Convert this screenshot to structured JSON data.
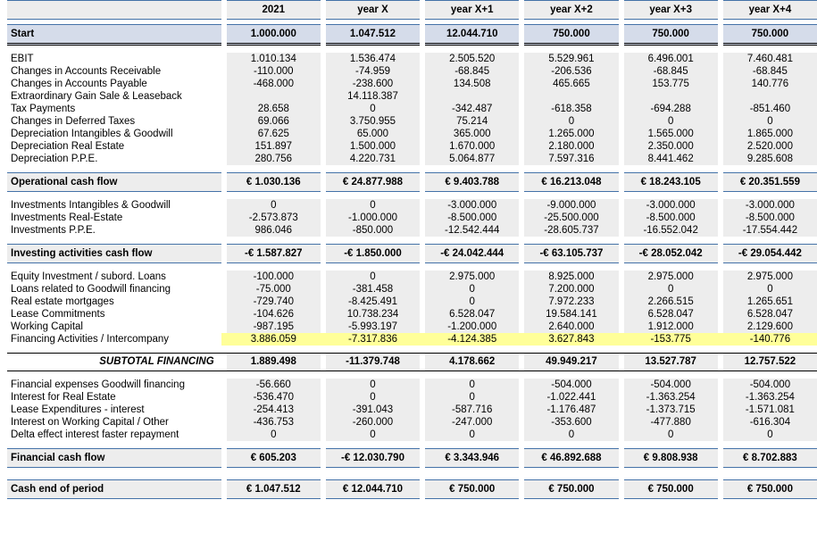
{
  "colors": {
    "accent_border": "#4472a8",
    "header_fill": "#ededed",
    "start_fill": "#d5dcea",
    "highlight_fill": "#ffff99",
    "total_border": "#000000"
  },
  "columns": [
    {
      "label": "2021"
    },
    {
      "label": "year X"
    },
    {
      "label": "year X+1"
    },
    {
      "label": "year X+2"
    },
    {
      "label": "year X+3"
    },
    {
      "label": "year X+4"
    }
  ],
  "header": {
    "corner_label": ""
  },
  "start_row": {
    "label": "Start",
    "values": [
      "1.000.000",
      "1.047.512",
      "12.044.710",
      "750.000",
      "750.000",
      "750.000"
    ]
  },
  "operational": {
    "rows": [
      {
        "label": "EBIT",
        "values": [
          "1.010.134",
          "1.536.474",
          "2.505.520",
          "5.529.961",
          "6.496.001",
          "7.460.481"
        ]
      },
      {
        "label": "Changes in Accounts Receivable",
        "values": [
          "-110.000",
          "-74.959",
          "-68.845",
          "-206.536",
          "-68.845",
          "-68.845"
        ]
      },
      {
        "label": "Changes in Accounts Payable",
        "values": [
          "-468.000",
          "-238.600",
          "134.508",
          "465.665",
          "153.775",
          "140.776"
        ]
      },
      {
        "label": "Extraordinary Gain Sale & Leaseback",
        "values": [
          "",
          "14.118.387",
          "",
          "",
          "",
          ""
        ]
      },
      {
        "label": "Tax Payments",
        "values": [
          "28.658",
          "0",
          "-342.487",
          "-618.358",
          "-694.288",
          "-851.460"
        ]
      },
      {
        "label": "Changes in Deferred Taxes",
        "values": [
          "69.066",
          "3.750.955",
          "75.214",
          "0",
          "0",
          "0"
        ]
      },
      {
        "label": "Depreciation Intangibles & Goodwill",
        "values": [
          "67.625",
          "65.000",
          "365.000",
          "1.265.000",
          "1.565.000",
          "1.865.000"
        ]
      },
      {
        "label": "Depreciation Real Estate",
        "values": [
          "151.897",
          "1.500.000",
          "1.670.000",
          "2.180.000",
          "2.350.000",
          "2.520.000"
        ]
      },
      {
        "label": "Depreciation P.P.E.",
        "values": [
          "280.756",
          "4.220.731",
          "5.064.877",
          "7.597.316",
          "8.441.462",
          "9.285.608"
        ]
      }
    ],
    "total": {
      "label": "Operational cash flow",
      "values": [
        "€ 1.030.136",
        "€ 24.877.988",
        "€ 9.403.788",
        "€ 16.213.048",
        "€ 18.243.105",
        "€ 20.351.559"
      ]
    }
  },
  "investing": {
    "rows": [
      {
        "label": "Investments Intangibles & Goodwill",
        "values": [
          "0",
          "0",
          "-3.000.000",
          "-9.000.000",
          "-3.000.000",
          "-3.000.000"
        ]
      },
      {
        "label": "Investments Real-Estate",
        "values": [
          "-2.573.873",
          "-1.000.000",
          "-8.500.000",
          "-25.500.000",
          "-8.500.000",
          "-8.500.000"
        ]
      },
      {
        "label": "Investments P.P.E.",
        "values": [
          "986.046",
          "-850.000",
          "-12.542.444",
          "-28.605.737",
          "-16.552.042",
          "-17.554.442"
        ]
      }
    ],
    "total": {
      "label": "Investing activities cash flow",
      "values": [
        "-€ 1.587.827",
        "-€ 1.850.000",
        "-€ 24.042.444",
        "-€ 63.105.737",
        "-€ 28.052.042",
        "-€ 29.054.442"
      ]
    }
  },
  "financing": {
    "rows": [
      {
        "label": "Equity Investment / subord. Loans",
        "values": [
          "-100.000",
          "0",
          "2.975.000",
          "8.925.000",
          "2.975.000",
          "2.975.000"
        ],
        "highlight": false
      },
      {
        "label": "Loans related to Goodwill financing",
        "values": [
          "-75.000",
          "-381.458",
          "0",
          "7.200.000",
          "0",
          "0"
        ],
        "highlight": false
      },
      {
        "label": "Real estate mortgages",
        "values": [
          "-729.740",
          "-8.425.491",
          "0",
          "7.972.233",
          "2.266.515",
          "1.265.651"
        ],
        "highlight": false
      },
      {
        "label": "Lease Commitments",
        "values": [
          "-104.626",
          "10.738.234",
          "6.528.047",
          "19.584.141",
          "6.528.047",
          "6.528.047"
        ],
        "highlight": false
      },
      {
        "label": "Working Capital",
        "values": [
          "-987.195",
          "-5.993.197",
          "-1.200.000",
          "2.640.000",
          "1.912.000",
          "2.129.600"
        ],
        "highlight": false
      },
      {
        "label": "Financing Activities / Intercompany",
        "values": [
          "3.886.059",
          "-7.317.836",
          "-4.124.385",
          "3.627.843",
          "-153.775",
          "-140.776"
        ],
        "highlight": true
      }
    ],
    "total": {
      "label": "SUBTOTAL FINANCING",
      "values": [
        "1.889.498",
        "-11.379.748",
        "4.178.662",
        "49.949.217",
        "13.527.787",
        "12.757.522"
      ]
    }
  },
  "financial_expenses": {
    "rows": [
      {
        "label": "Financial expenses Goodwill financing",
        "values": [
          "-56.660",
          "0",
          "0",
          "-504.000",
          "-504.000",
          "-504.000"
        ]
      },
      {
        "label": "Interest for Real Estate",
        "values": [
          "-536.470",
          "0",
          "0",
          "-1.022.441",
          "-1.363.254",
          "-1.363.254"
        ]
      },
      {
        "label": "Lease Expenditures - interest",
        "values": [
          "-254.413",
          "-391.043",
          "-587.716",
          "-1.176.487",
          "-1.373.715",
          "-1.571.081"
        ]
      },
      {
        "label": "Interest on Working Capital / Other",
        "values": [
          "-436.753",
          "-260.000",
          "-247.000",
          "-353.600",
          "-477.880",
          "-616.304"
        ]
      },
      {
        "label": "Delta effect interest faster repayment",
        "values": [
          "0",
          "0",
          "0",
          "0",
          "0",
          "0"
        ]
      }
    ],
    "total": {
      "label": "Financial cash flow",
      "values": [
        "€ 605.203",
        "-€ 12.030.790",
        "€ 3.343.946",
        "€ 46.892.688",
        "€ 9.808.938",
        "€ 8.702.883"
      ]
    }
  },
  "cash_end": {
    "label": "Cash end of period",
    "values": [
      "€ 1.047.512",
      "€ 12.044.710",
      "€ 750.000",
      "€ 750.000",
      "€ 750.000",
      "€ 750.000"
    ]
  }
}
